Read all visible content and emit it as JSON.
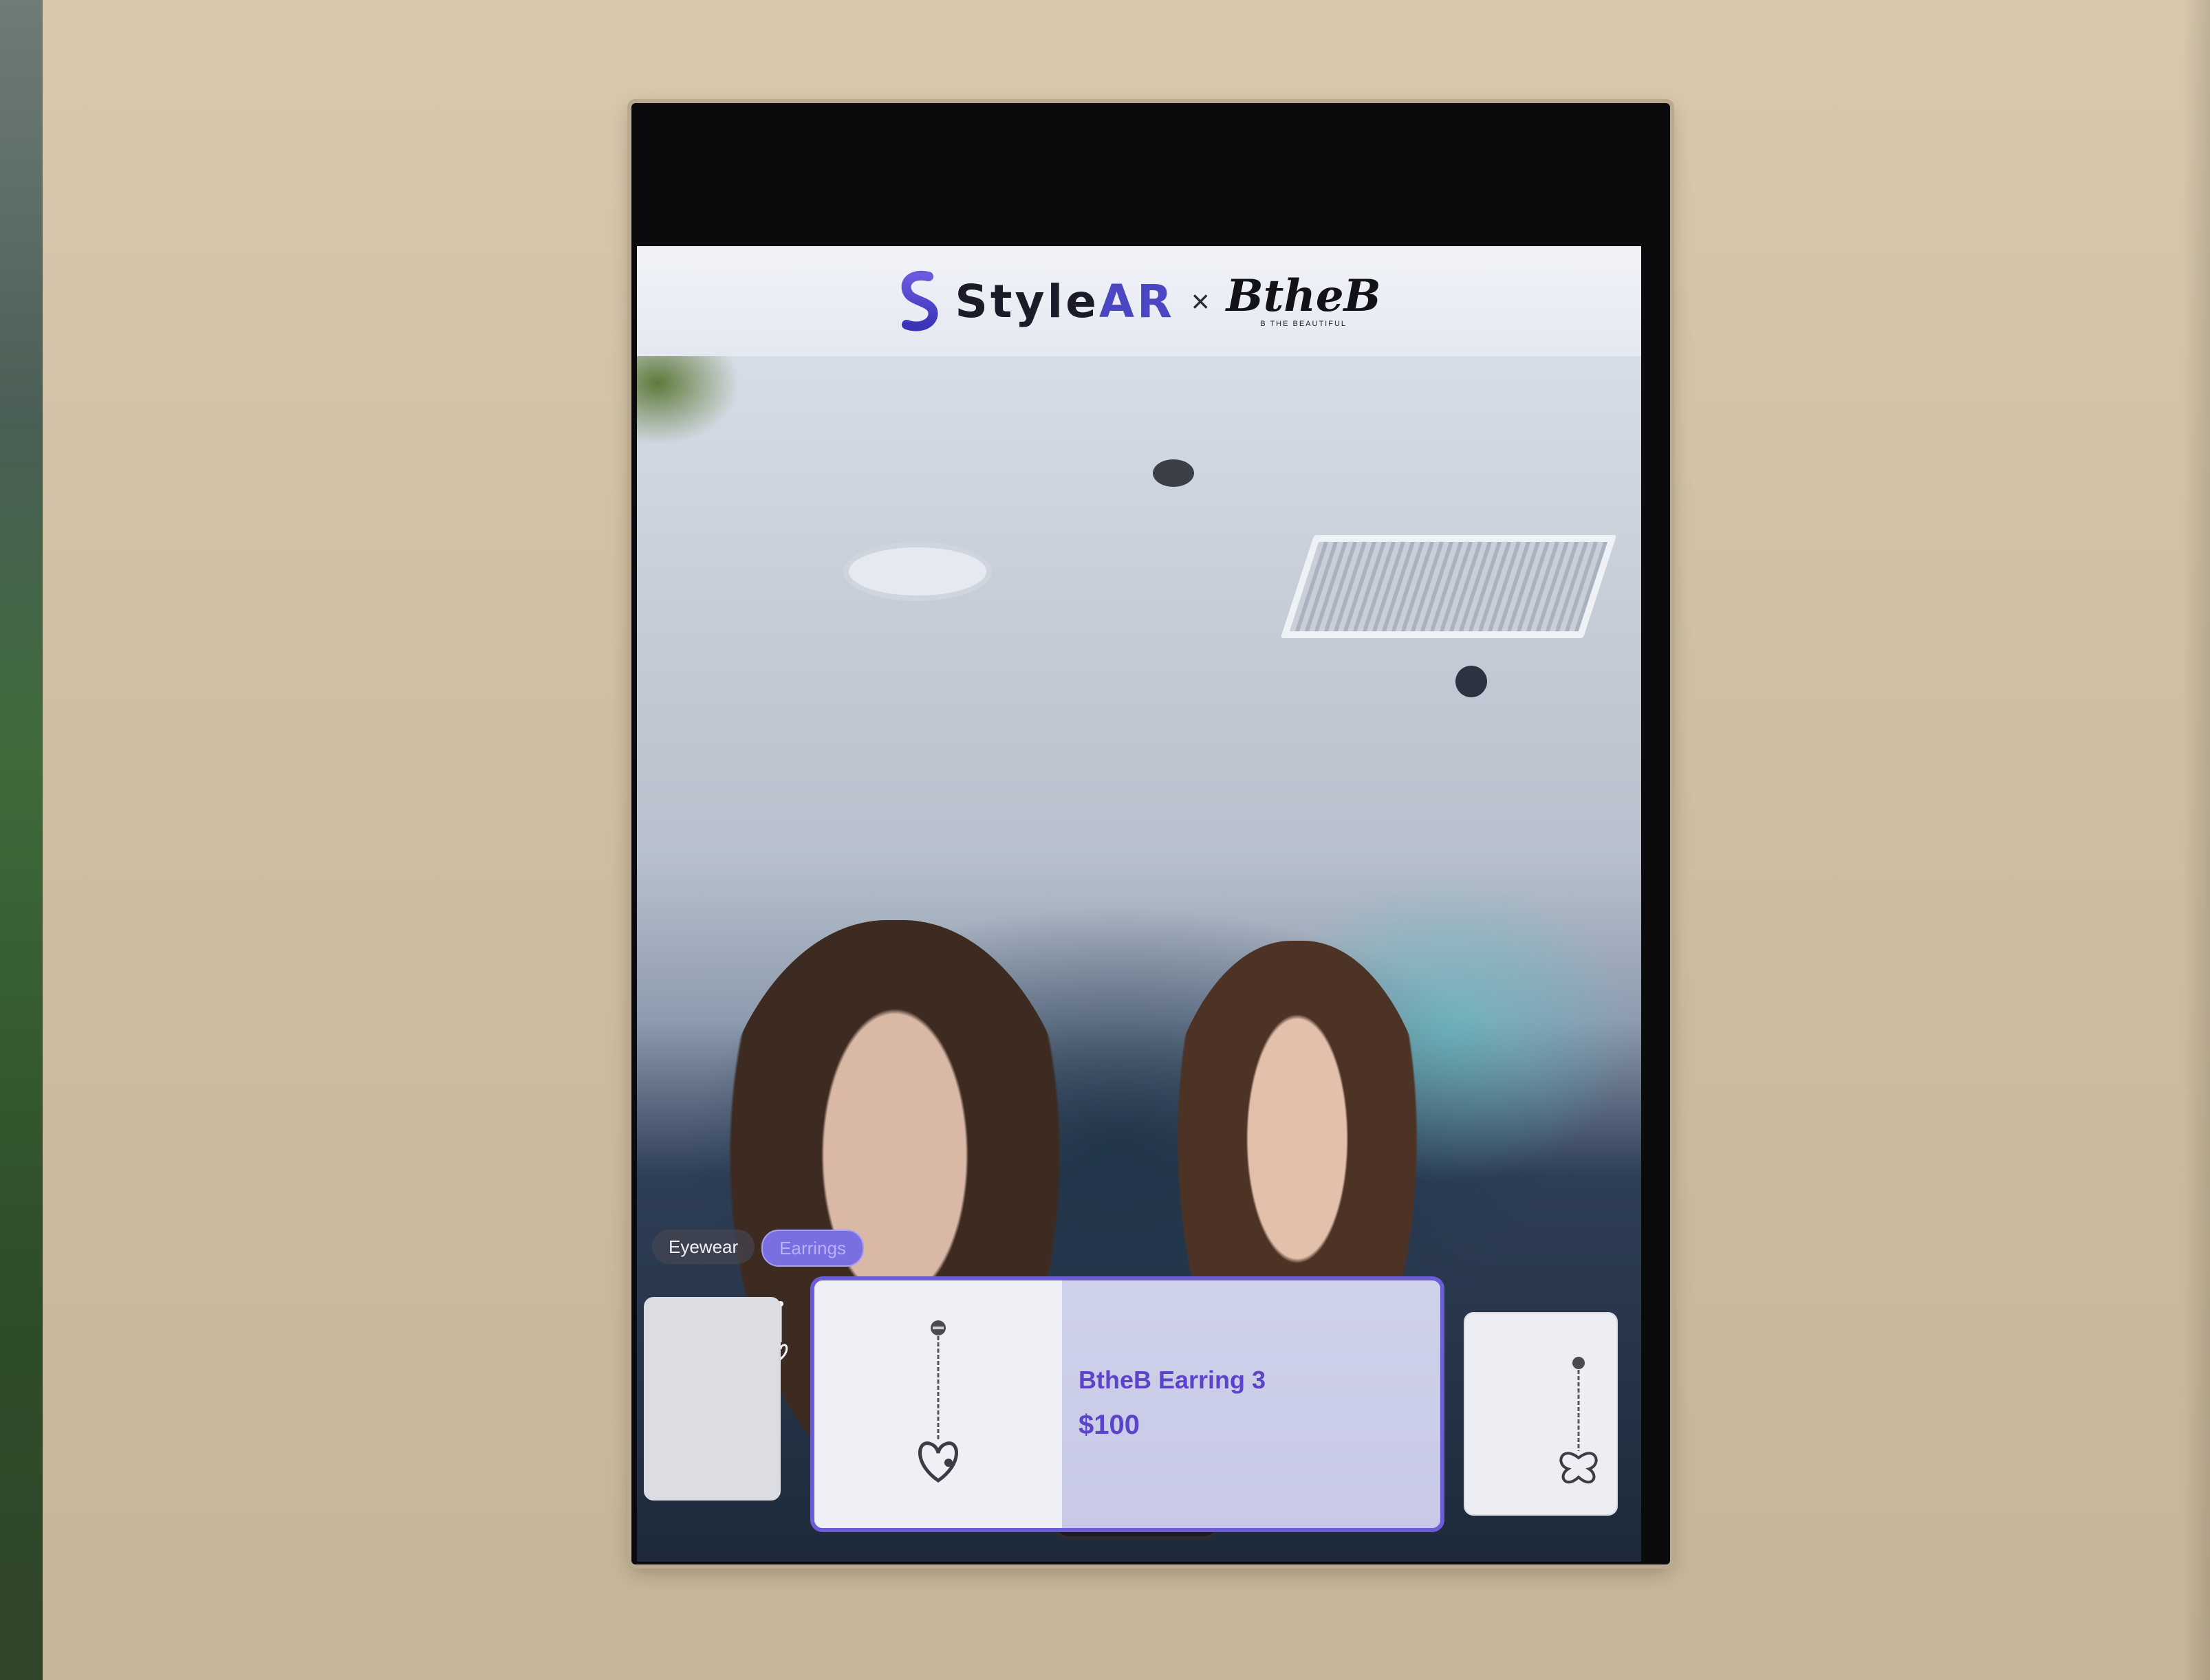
{
  "header": {
    "brand_prefix": "Style",
    "brand_suffix": "AR",
    "separator": "×",
    "partner": "BtheB",
    "partner_tagline": "B THE BEAUTIFUL",
    "accent_color": "#4b46c4"
  },
  "categories": [
    {
      "label": "Eyewear",
      "selected": false
    },
    {
      "label": "Earrings",
      "selected": true
    }
  ],
  "products": {
    "selected": {
      "name": "BtheB Earring 3",
      "price": "$100",
      "icon": "heart-drop-earring-icon"
    },
    "next_icon": "butterfly-drop-earring-icon",
    "highlight_color": "#6b5cd8"
  }
}
